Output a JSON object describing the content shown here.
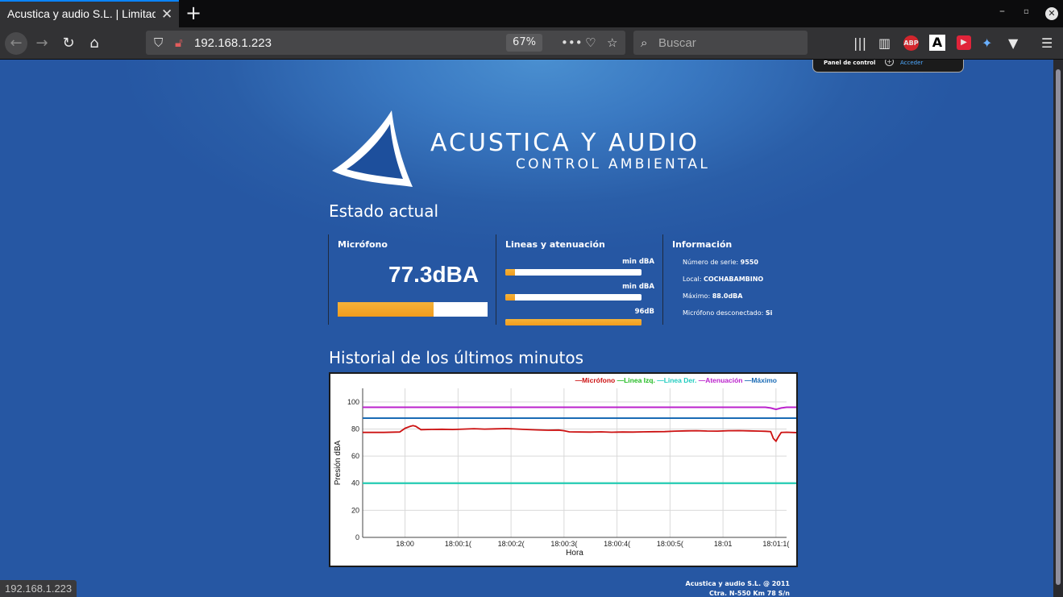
{
  "browser": {
    "tab_title": "Acustica y audio S.L. | Limitador",
    "url": "192.168.1.223",
    "zoom": "67%",
    "search_placeholder": "Buscar",
    "status_url": "192.168.1.223",
    "ext_abp": "ABP",
    "ext_a": "A"
  },
  "panel": {
    "label": "Panel de control",
    "link": "Acceder"
  },
  "logo": {
    "title": "ACUSTICA Y AUDIO",
    "subtitle": "CONTROL AMBIENTAL"
  },
  "estado": {
    "heading": "Estado actual",
    "microfono": {
      "title": "Micrófono",
      "value": "77.3dBA",
      "level": 0.64
    },
    "lineas": {
      "title": "Lineas y atenuación",
      "bars": [
        {
          "label": "min dBA",
          "level": 0.07
        },
        {
          "label": "min dBA",
          "level": 0.07
        },
        {
          "label": "96dB",
          "level": 1.0
        }
      ]
    },
    "info": {
      "title": "Información",
      "items": [
        {
          "label": "Número de serie:",
          "value": "9550"
        },
        {
          "label": "Local:",
          "value": "COCHABAMBINO"
        },
        {
          "label": "Máximo:",
          "value": "88.0dBA"
        },
        {
          "label": "Micrófono desconectado:",
          "value": "Si"
        }
      ]
    }
  },
  "historial": {
    "heading": "Historial de los últimos minutos"
  },
  "colors": {
    "microfono": "#cc1111",
    "linea_izq": "#22bb22",
    "linea_der": "#22ccc0",
    "atenuacion": "#bb22cc",
    "maximo": "#1a6bb5",
    "bar_fill": "#f4a62a"
  },
  "chart_data": {
    "type": "line",
    "xlabel": "Hora",
    "ylabel": "Presión dBA",
    "ylim": [
      0,
      110
    ],
    "yticks": [
      0,
      20,
      40,
      60,
      80,
      100
    ],
    "xlim": [
      -8,
      72
    ],
    "xticks": [
      {
        "t": 0,
        "label": "18:00"
      },
      {
        "t": 10,
        "label": "18:00:1("
      },
      {
        "t": 20,
        "label": "18:00:2("
      },
      {
        "t": 30,
        "label": "18:00:3("
      },
      {
        "t": 40,
        "label": "18:00:4("
      },
      {
        "t": 50,
        "label": "18:00:5("
      },
      {
        "t": 60,
        "label": "18:01"
      },
      {
        "t": 70,
        "label": "18:01:1("
      }
    ],
    "legend": "top-right",
    "series": [
      {
        "name": "Micrófono",
        "color": "#cc1111",
        "x": [
          -8,
          -4,
          -1,
          0,
          1,
          1.5,
          2,
          3,
          5,
          7,
          9,
          11,
          13,
          15,
          17,
          19,
          21,
          23,
          25,
          27,
          29,
          30,
          31,
          33,
          35,
          37,
          39,
          41,
          43,
          45,
          47,
          49,
          51,
          53,
          55,
          57,
          59,
          61,
          63,
          65,
          67,
          68,
          69,
          69.5,
          70,
          70.5,
          71,
          72,
          74,
          76,
          77.5
        ],
        "y": [
          77.5,
          77.5,
          77.8,
          80.5,
          82,
          82.5,
          82,
          79.5,
          79.7,
          79.8,
          79.6,
          79.9,
          80.2,
          79.9,
          80.1,
          80.3,
          80,
          79.6,
          79.3,
          79.1,
          79.2,
          78.7,
          77.9,
          77.8,
          77.7,
          77.9,
          77.6,
          77.8,
          77.7,
          77.9,
          78,
          78.1,
          78.4,
          78.6,
          78.7,
          78.5,
          78.4,
          78.7,
          78.8,
          78.6,
          78.4,
          78.3,
          78.1,
          73,
          71,
          74.5,
          77.5,
          77.6,
          77.3,
          77.4,
          77.3
        ]
      },
      {
        "name": "Linea Izq.",
        "color": "#22bb22",
        "x": [
          -8,
          77.5
        ],
        "y": [
          40,
          40
        ]
      },
      {
        "name": "Linea Der.",
        "color": "#22ccc0",
        "x": [
          -8,
          77.5
        ],
        "y": [
          40,
          40
        ]
      },
      {
        "name": "Atenuación",
        "color": "#bb22cc",
        "x": [
          -8,
          68,
          69,
          70,
          71,
          72,
          77.5
        ],
        "y": [
          96,
          96,
          95.5,
          94.5,
          95.5,
          96,
          96
        ]
      },
      {
        "name": "Máximo",
        "color": "#1a6bb5",
        "x": [
          -8,
          77.5
        ],
        "y": [
          88,
          88
        ]
      }
    ]
  },
  "footer": {
    "line1": "Acustica y audio S.L. @ 2011",
    "line2": "Ctra. N-550 Km 78 S/n"
  }
}
